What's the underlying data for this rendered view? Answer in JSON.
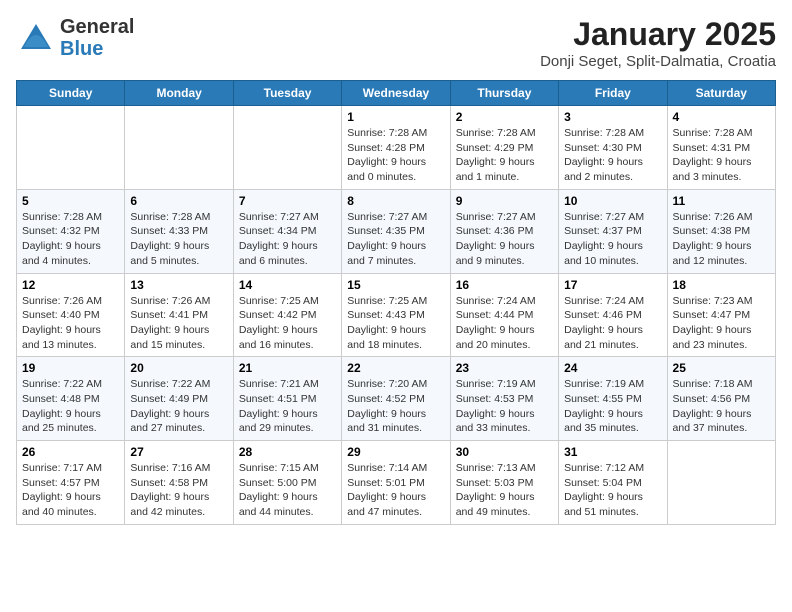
{
  "header": {
    "logo": {
      "line1": "General",
      "line2": "Blue"
    },
    "title": "January 2025",
    "subtitle": "Donji Seget, Split-Dalmatia, Croatia"
  },
  "weekdays": [
    "Sunday",
    "Monday",
    "Tuesday",
    "Wednesday",
    "Thursday",
    "Friday",
    "Saturday"
  ],
  "weeks": [
    [
      {
        "day": "",
        "sunrise": "",
        "sunset": "",
        "daylight": ""
      },
      {
        "day": "",
        "sunrise": "",
        "sunset": "",
        "daylight": ""
      },
      {
        "day": "",
        "sunrise": "",
        "sunset": "",
        "daylight": ""
      },
      {
        "day": "1",
        "sunrise": "Sunrise: 7:28 AM",
        "sunset": "Sunset: 4:28 PM",
        "daylight": "Daylight: 9 hours and 0 minutes."
      },
      {
        "day": "2",
        "sunrise": "Sunrise: 7:28 AM",
        "sunset": "Sunset: 4:29 PM",
        "daylight": "Daylight: 9 hours and 1 minute."
      },
      {
        "day": "3",
        "sunrise": "Sunrise: 7:28 AM",
        "sunset": "Sunset: 4:30 PM",
        "daylight": "Daylight: 9 hours and 2 minutes."
      },
      {
        "day": "4",
        "sunrise": "Sunrise: 7:28 AM",
        "sunset": "Sunset: 4:31 PM",
        "daylight": "Daylight: 9 hours and 3 minutes."
      }
    ],
    [
      {
        "day": "5",
        "sunrise": "Sunrise: 7:28 AM",
        "sunset": "Sunset: 4:32 PM",
        "daylight": "Daylight: 9 hours and 4 minutes."
      },
      {
        "day": "6",
        "sunrise": "Sunrise: 7:28 AM",
        "sunset": "Sunset: 4:33 PM",
        "daylight": "Daylight: 9 hours and 5 minutes."
      },
      {
        "day": "7",
        "sunrise": "Sunrise: 7:27 AM",
        "sunset": "Sunset: 4:34 PM",
        "daylight": "Daylight: 9 hours and 6 minutes."
      },
      {
        "day": "8",
        "sunrise": "Sunrise: 7:27 AM",
        "sunset": "Sunset: 4:35 PM",
        "daylight": "Daylight: 9 hours and 7 minutes."
      },
      {
        "day": "9",
        "sunrise": "Sunrise: 7:27 AM",
        "sunset": "Sunset: 4:36 PM",
        "daylight": "Daylight: 9 hours and 9 minutes."
      },
      {
        "day": "10",
        "sunrise": "Sunrise: 7:27 AM",
        "sunset": "Sunset: 4:37 PM",
        "daylight": "Daylight: 9 hours and 10 minutes."
      },
      {
        "day": "11",
        "sunrise": "Sunrise: 7:26 AM",
        "sunset": "Sunset: 4:38 PM",
        "daylight": "Daylight: 9 hours and 12 minutes."
      }
    ],
    [
      {
        "day": "12",
        "sunrise": "Sunrise: 7:26 AM",
        "sunset": "Sunset: 4:40 PM",
        "daylight": "Daylight: 9 hours and 13 minutes."
      },
      {
        "day": "13",
        "sunrise": "Sunrise: 7:26 AM",
        "sunset": "Sunset: 4:41 PM",
        "daylight": "Daylight: 9 hours and 15 minutes."
      },
      {
        "day": "14",
        "sunrise": "Sunrise: 7:25 AM",
        "sunset": "Sunset: 4:42 PM",
        "daylight": "Daylight: 9 hours and 16 minutes."
      },
      {
        "day": "15",
        "sunrise": "Sunrise: 7:25 AM",
        "sunset": "Sunset: 4:43 PM",
        "daylight": "Daylight: 9 hours and 18 minutes."
      },
      {
        "day": "16",
        "sunrise": "Sunrise: 7:24 AM",
        "sunset": "Sunset: 4:44 PM",
        "daylight": "Daylight: 9 hours and 20 minutes."
      },
      {
        "day": "17",
        "sunrise": "Sunrise: 7:24 AM",
        "sunset": "Sunset: 4:46 PM",
        "daylight": "Daylight: 9 hours and 21 minutes."
      },
      {
        "day": "18",
        "sunrise": "Sunrise: 7:23 AM",
        "sunset": "Sunset: 4:47 PM",
        "daylight": "Daylight: 9 hours and 23 minutes."
      }
    ],
    [
      {
        "day": "19",
        "sunrise": "Sunrise: 7:22 AM",
        "sunset": "Sunset: 4:48 PM",
        "daylight": "Daylight: 9 hours and 25 minutes."
      },
      {
        "day": "20",
        "sunrise": "Sunrise: 7:22 AM",
        "sunset": "Sunset: 4:49 PM",
        "daylight": "Daylight: 9 hours and 27 minutes."
      },
      {
        "day": "21",
        "sunrise": "Sunrise: 7:21 AM",
        "sunset": "Sunset: 4:51 PM",
        "daylight": "Daylight: 9 hours and 29 minutes."
      },
      {
        "day": "22",
        "sunrise": "Sunrise: 7:20 AM",
        "sunset": "Sunset: 4:52 PM",
        "daylight": "Daylight: 9 hours and 31 minutes."
      },
      {
        "day": "23",
        "sunrise": "Sunrise: 7:19 AM",
        "sunset": "Sunset: 4:53 PM",
        "daylight": "Daylight: 9 hours and 33 minutes."
      },
      {
        "day": "24",
        "sunrise": "Sunrise: 7:19 AM",
        "sunset": "Sunset: 4:55 PM",
        "daylight": "Daylight: 9 hours and 35 minutes."
      },
      {
        "day": "25",
        "sunrise": "Sunrise: 7:18 AM",
        "sunset": "Sunset: 4:56 PM",
        "daylight": "Daylight: 9 hours and 37 minutes."
      }
    ],
    [
      {
        "day": "26",
        "sunrise": "Sunrise: 7:17 AM",
        "sunset": "Sunset: 4:57 PM",
        "daylight": "Daylight: 9 hours and 40 minutes."
      },
      {
        "day": "27",
        "sunrise": "Sunrise: 7:16 AM",
        "sunset": "Sunset: 4:58 PM",
        "daylight": "Daylight: 9 hours and 42 minutes."
      },
      {
        "day": "28",
        "sunrise": "Sunrise: 7:15 AM",
        "sunset": "Sunset: 5:00 PM",
        "daylight": "Daylight: 9 hours and 44 minutes."
      },
      {
        "day": "29",
        "sunrise": "Sunrise: 7:14 AM",
        "sunset": "Sunset: 5:01 PM",
        "daylight": "Daylight: 9 hours and 47 minutes."
      },
      {
        "day": "30",
        "sunrise": "Sunrise: 7:13 AM",
        "sunset": "Sunset: 5:03 PM",
        "daylight": "Daylight: 9 hours and 49 minutes."
      },
      {
        "day": "31",
        "sunrise": "Sunrise: 7:12 AM",
        "sunset": "Sunset: 5:04 PM",
        "daylight": "Daylight: 9 hours and 51 minutes."
      },
      {
        "day": "",
        "sunrise": "",
        "sunset": "",
        "daylight": ""
      }
    ]
  ]
}
